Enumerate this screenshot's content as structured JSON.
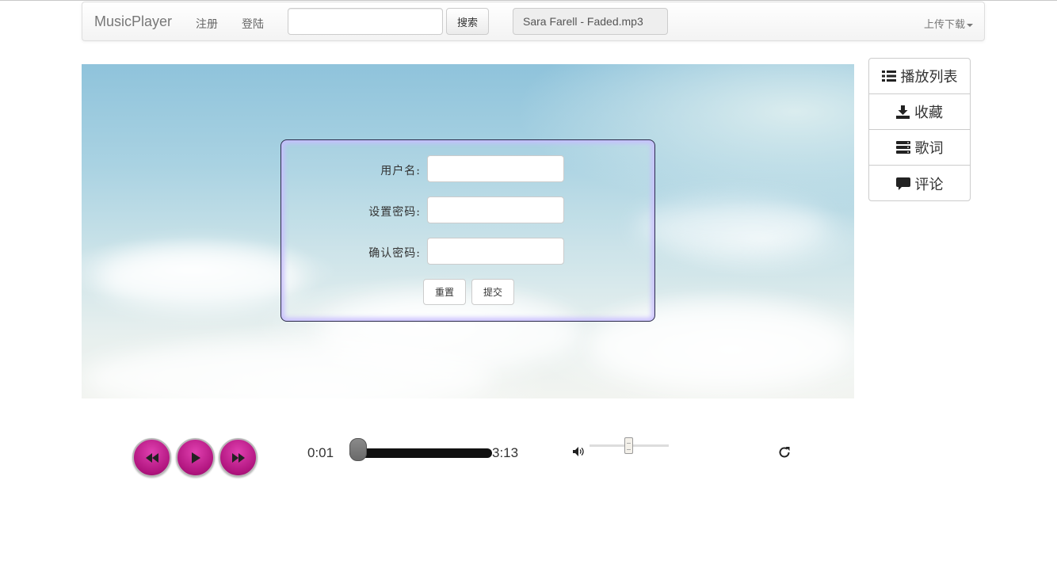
{
  "navbar": {
    "brand": "MusicPlayer",
    "register": "注册",
    "login": "登陆",
    "search_value": "",
    "search_button": "搜索",
    "now_playing": "Sara Farell - Faded.mp3",
    "upload_download": "上传下载"
  },
  "form": {
    "username_label": "用户名:",
    "password_label": "设置密码:",
    "confirm_label": "确认密码:",
    "username_value": "",
    "password_value": "",
    "confirm_value": "",
    "reset_button": "重置",
    "submit_button": "提交"
  },
  "side_menu": [
    {
      "icon": "list-icon",
      "label": "播放列表"
    },
    {
      "icon": "download-icon",
      "label": "收藏"
    },
    {
      "icon": "server-icon",
      "label": "歌词"
    },
    {
      "icon": "comment-icon",
      "label": "评论"
    }
  ],
  "player": {
    "current_time": "0:01",
    "total_time": "3:13",
    "progress_fraction": 0.005,
    "volume_fraction": 0.5,
    "accent_color": "#c01a8c"
  }
}
